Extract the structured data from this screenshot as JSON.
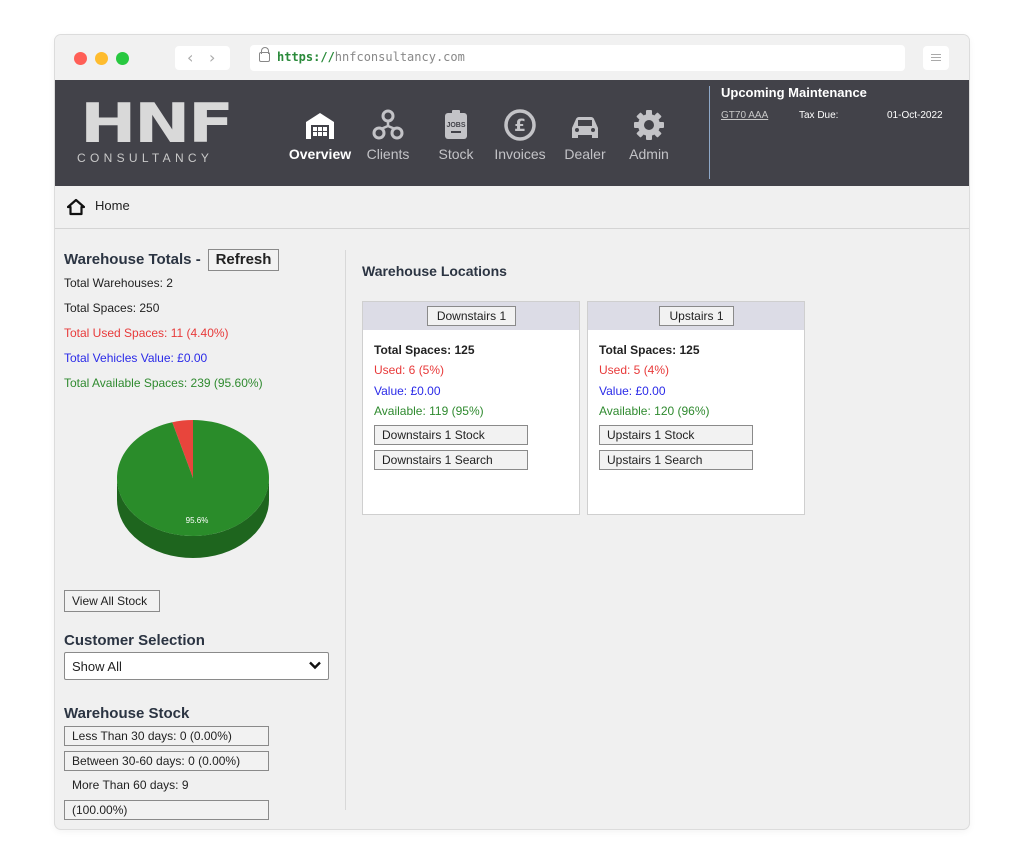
{
  "browser": {
    "url_protocol": "https://",
    "url_host": "hnfconsultancy.com"
  },
  "header": {
    "logo_text": "HNF",
    "logo_subtext": "CONSULTANCY",
    "nav": [
      {
        "label": "Overview",
        "icon": "warehouse-icon",
        "active": true
      },
      {
        "label": "Clients",
        "icon": "people-network-icon",
        "active": false
      },
      {
        "label": "Stock",
        "icon": "jobs-clipboard-icon",
        "active": false
      },
      {
        "label": "Invoices",
        "icon": "pound-coin-icon",
        "active": false
      },
      {
        "label": "Dealer",
        "icon": "car-icon",
        "active": false
      },
      {
        "label": "Admin",
        "icon": "gear-icon",
        "active": false
      }
    ],
    "maintenance": {
      "title": "Upcoming Maintenance",
      "registration": "GT70 AAA",
      "tax_label": "Tax Due:",
      "date": "01-Oct-2022"
    }
  },
  "breadcrumb": {
    "home_label": "Home"
  },
  "warehouse_totals": {
    "title": "Warehouse Totals -",
    "refresh_label": "Refresh",
    "total_warehouses": "Total Warehouses: 2",
    "total_spaces": "Total Spaces: 250",
    "used_spaces": "Total Used Spaces: 11 (4.40%)",
    "vehicles_value": "Total Vehicles Value: £0.00",
    "available_spaces": "Total Available Spaces: 239 (95.60%)"
  },
  "chart_data": {
    "type": "pie",
    "slices": [
      {
        "label": "Used",
        "value": 4.4,
        "color": "#e8453c"
      },
      {
        "label": "Available",
        "value": 95.6,
        "color": "#2a8c2a"
      }
    ],
    "data_label": "95.6%"
  },
  "view_all_label": "View All Stock",
  "customer_selection": {
    "title": "Customer Selection",
    "selected": "Show All"
  },
  "warehouse_stock": {
    "title": "Warehouse Stock",
    "lt30": "Less Than 30 days: 0 (0.00%)",
    "b30_60": "Between 30-60 days: 0 (0.00%)",
    "gt60": "More Than 60 days: 9",
    "gt60_pct": "(100.00%)"
  },
  "locations": {
    "title": "Warehouse Locations",
    "cards": [
      {
        "name": "Downstairs 1",
        "total": "Total Spaces: 125",
        "used": "Used: 6 (5%)",
        "value": "Value: £0.00",
        "available": "Available: 119 (95%)",
        "stock_btn": "Downstairs 1 Stock",
        "search_btn": "Downstairs 1 Search"
      },
      {
        "name": "Upstairs 1",
        "total": "Total Spaces: 125",
        "used": "Used: 5 (4%)",
        "value": "Value: £0.00",
        "available": "Available: 120 (96%)",
        "stock_btn": "Upstairs 1 Stock",
        "search_btn": "Upstairs 1 Search"
      }
    ]
  }
}
